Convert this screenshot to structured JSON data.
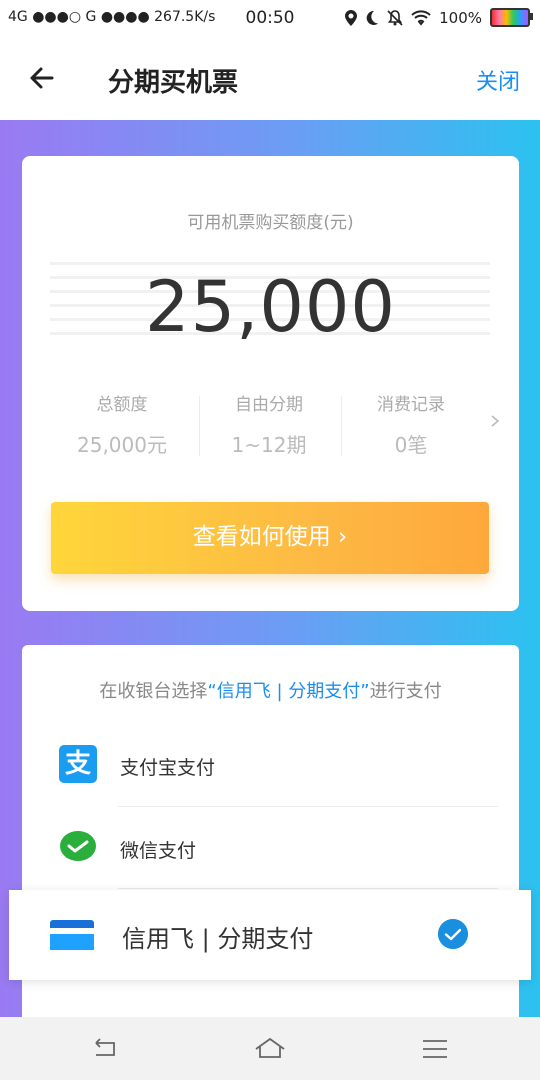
{
  "status_bar": {
    "left": "4G ●●●○ G ●●●● 267.5K/s",
    "time": "00:50",
    "battery": "100%"
  },
  "nav": {
    "title": "分期买机票",
    "close_label": "关闭"
  },
  "credit_card": {
    "label": "可用机票购买额度(元)",
    "amount": "25,000",
    "stats": [
      {
        "key": "总额度",
        "value": "25,000元"
      },
      {
        "key": "自由分期",
        "value": "1~12期"
      },
      {
        "key": "消费记录",
        "value": "0笔"
      }
    ],
    "howto_label": "查看如何使用 ›"
  },
  "payment": {
    "tip_prefix": "在收银台选择",
    "tip_highlight": "“信用飞 | 分期支付”",
    "tip_suffix": "进行支付",
    "alipay_glyph": "支",
    "options": [
      {
        "label": "支付宝支付",
        "icon": "alipay-icon"
      },
      {
        "label": "微信支付",
        "icon": "wechat-pay-icon"
      }
    ],
    "selected": {
      "label": "信用飞 | 分期支付",
      "icon": "bank-card-icon",
      "checked": true
    }
  },
  "colors": {
    "accent": "#1a8ff0",
    "button_gradient_start": "#fed63a",
    "button_gradient_end": "#fea83c",
    "bg_gradient_start": "#9a7af2",
    "bg_gradient_end": "#2bc2ef"
  }
}
